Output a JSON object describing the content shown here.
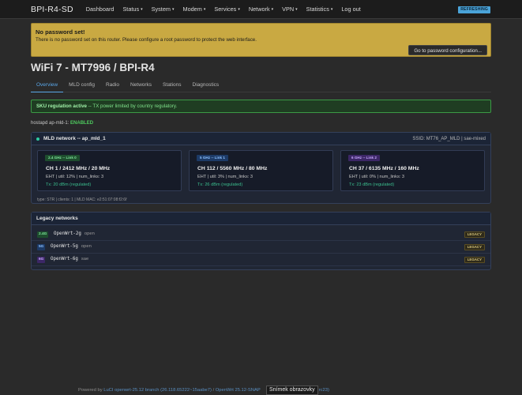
{
  "nav": {
    "brand": "BPI-R4-SD",
    "items": [
      {
        "label": "Dashboard",
        "dropdown": false
      },
      {
        "label": "Status",
        "dropdown": true
      },
      {
        "label": "System",
        "dropdown": true
      },
      {
        "label": "Modem",
        "dropdown": true
      },
      {
        "label": "Services",
        "dropdown": true
      },
      {
        "label": "Network",
        "dropdown": true
      },
      {
        "label": "VPN",
        "dropdown": true
      },
      {
        "label": "Statistics",
        "dropdown": true
      },
      {
        "label": "Log out",
        "dropdown": false
      }
    ],
    "refresh_badge": "REFRESHING",
    "caret": "▾"
  },
  "warning": {
    "title": "No password set!",
    "text": "There is no password set on this router. Please configure a root password to protect the web interface.",
    "button": "Go to password configuration..."
  },
  "page_title": "WiFi 7 - MT7996 / BPI-R4",
  "tabs": [
    "Overview",
    "MLD config",
    "Radio",
    "Networks",
    "Stations",
    "Diagnostics"
  ],
  "active_tab": 0,
  "sku": {
    "strong": "SKU regulation active",
    "rest": " -- TX power limited by country regulatory."
  },
  "hostapd": {
    "label": "hostapd ap-mld-1: ",
    "status": "ENABLED"
  },
  "mld": {
    "title": "MLD network -- ap_mld_1",
    "ssid_info": "SSID: MT76_AP_MLD | sae-mixed",
    "links": [
      {
        "badge": "2.4 GHz -- Link 0",
        "channel": "CH 1 / 2412 MHz / 20 MHz",
        "eht": "EHT | util: 12% | num_links: 3",
        "tx": "Tx: 20 dBm (regulated)",
        "badge_bg": "#1e4d2e",
        "badge_fg": "#7ee59b"
      },
      {
        "badge": "5 GHz -- Link 1",
        "channel": "CH 112 / 5560 MHz / 80 MHz",
        "eht": "EHT | util: 3% | num_links: 3",
        "tx": "Tx: 26 dBm (regulated)",
        "badge_bg": "#1d3a66",
        "badge_fg": "#8cc0ff"
      },
      {
        "badge": "6 GHz -- Link 2",
        "channel": "CH 37 / 6135 MHz / 160 MHz",
        "eht": "EHT | util: 0% | num_links: 3",
        "tx": "Tx: 23 dBm (regulated)",
        "badge_bg": "#3c2766",
        "badge_fg": "#c6a6ff"
      }
    ],
    "footer": "type: STR | clients: 1 | MLD MAC: e2:51:07:08:f2:6f"
  },
  "legacy": {
    "title": "Legacy networks",
    "rows": [
      {
        "band": "2.4G",
        "ssid": "OpenWrt-2g",
        "enc": "open",
        "badge": "LEGACY",
        "band_bg": "#1e4d2e",
        "band_fg": "#7ee59b"
      },
      {
        "band": "5G",
        "ssid": "OpenWrt-5g",
        "enc": "open",
        "badge": "LEGACY",
        "band_bg": "#1d3a66",
        "band_fg": "#8cc0ff"
      },
      {
        "band": "6G",
        "ssid": "OpenWrt-6g",
        "enc": "sae",
        "badge": "LEGACY",
        "band_bg": "#3c2766",
        "band_fg": "#c6a6ff"
      }
    ]
  },
  "footer": {
    "pre": "Powered by ",
    "luci": "LuCI openwrt-25.12 branch (26.118.65222~15aabe7)",
    "mid": " / ",
    "openwrt": "OpenWrt 25.12-SNAP",
    "tail": "rc23)"
  },
  "tooltip": "Snímek obrazovky"
}
